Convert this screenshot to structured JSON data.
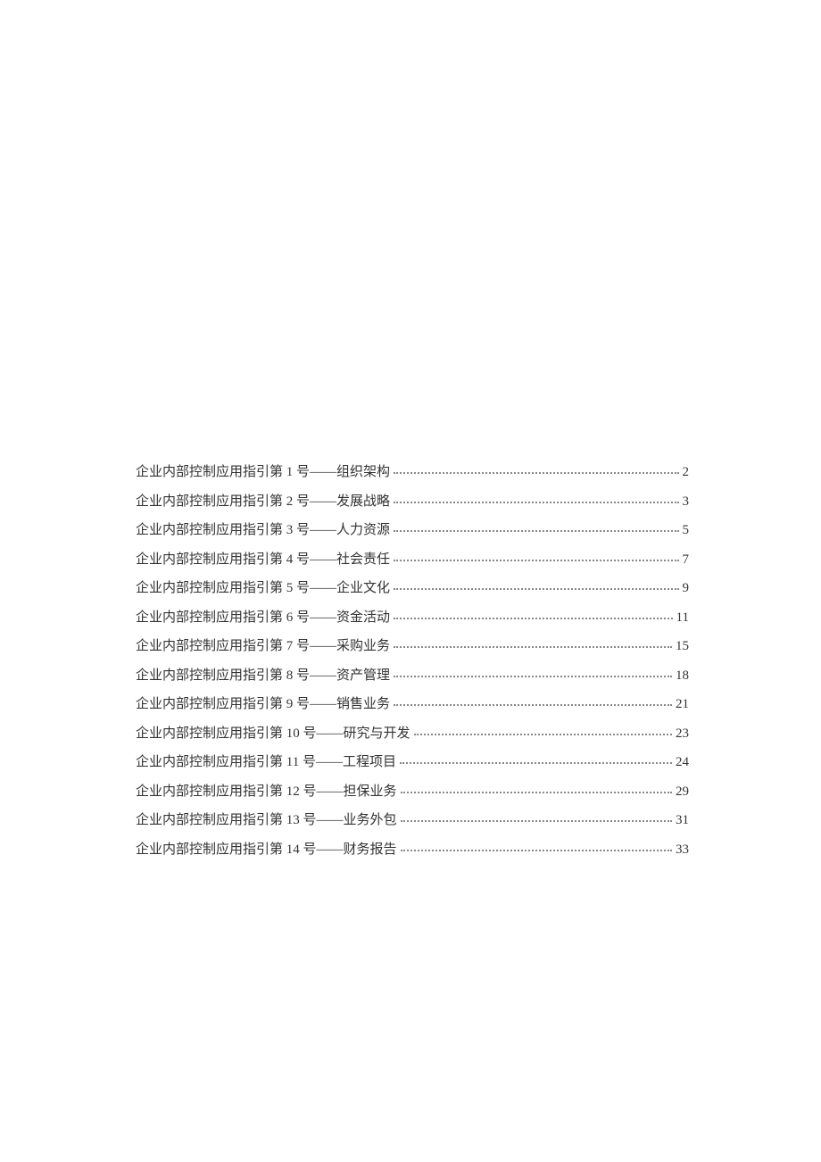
{
  "toc": {
    "entries": [
      {
        "title": "企业内部控制应用指引第 1 号——组织架构",
        "page": "2"
      },
      {
        "title": "企业内部控制应用指引第 2 号——发展战略",
        "page": "3"
      },
      {
        "title": "企业内部控制应用指引第 3 号——人力资源",
        "page": "5"
      },
      {
        "title": "企业内部控制应用指引第 4 号——社会责任",
        "page": "7"
      },
      {
        "title": "企业内部控制应用指引第 5 号——企业文化",
        "page": "9"
      },
      {
        "title": "企业内部控制应用指引第 6 号——资金活动",
        "page": "11"
      },
      {
        "title": "企业内部控制应用指引第 7 号——采购业务",
        "page": "15"
      },
      {
        "title": "企业内部控制应用指引第 8 号——资产管理",
        "page": "18"
      },
      {
        "title": "企业内部控制应用指引第 9 号——销售业务",
        "page": "21"
      },
      {
        "title": "企业内部控制应用指引第 10 号——研究与开发",
        "page": "23"
      },
      {
        "title": "企业内部控制应用指引第 11 号——工程项目",
        "page": "24"
      },
      {
        "title": "企业内部控制应用指引第 12 号——担保业务",
        "page": "29"
      },
      {
        "title": "企业内部控制应用指引第 13 号——业务外包",
        "page": "31"
      },
      {
        "title": "企业内部控制应用指引第 14 号——财务报告",
        "page": "33"
      }
    ]
  }
}
